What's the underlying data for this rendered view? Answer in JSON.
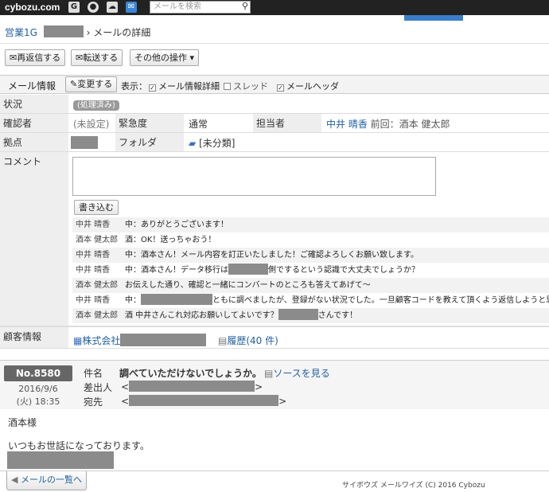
{
  "topbar": {
    "logo": "cybozu.com",
    "icons": [
      "g-icon",
      "target-icon",
      "globe-icon",
      "mail-icon"
    ],
    "search_placeholder": "メールを検索"
  },
  "breadcrumb": {
    "group": "営業1G",
    "separator": "›",
    "title": "メールの詳細"
  },
  "toolbar": {
    "reply": "再返信する",
    "forward": "転送する",
    "other": "その他の操作"
  },
  "infobar": {
    "label": "メール情報",
    "change": "変更する",
    "display": "表示：",
    "opt_detail": "メール情報詳細",
    "opt_thread": "スレッド",
    "opt_header": "メールヘッダ"
  },
  "status": {
    "label": "状況",
    "value": "処理済み"
  },
  "confirm": {
    "label": "確認者",
    "value": "(未設定)",
    "urgency_label": "緊急度",
    "urgency_value": "通常",
    "owner_label": "担当者",
    "owner_value": "中井 晴香",
    "previous": "前回：酒本 健太郎"
  },
  "base": {
    "label": "拠点",
    "folder_label": "フォルダ",
    "folder_value": "[未分類]"
  },
  "comment": {
    "label": "コメント",
    "submit": "書き込む",
    "entries": [
      {
        "who": "中井 晴香",
        "msg": "中：ありがとうございます！"
      },
      {
        "who": "酒本 健太郎",
        "msg": "酒：OK！送っちゃおう！"
      },
      {
        "who": "中井 晴香",
        "msg": "中：酒本さん！メール内容を訂正いたしました！ご確認よろしくお願い致します。"
      },
      {
        "who": "中井 晴香",
        "msg_pre": "中：酒本さん！データ移行は",
        "msg_post": "側でするという認識で大丈夫でしょうか？"
      },
      {
        "who": "酒本 健太郎",
        "msg": "お伝えした通り、確認と一緒にコンバートのところも答えてあげて〜"
      },
      {
        "who": "中井 晴香",
        "msg_pre": "中：",
        "msg_post": "ともに調べましたが、登録がない状況でした。一旦顧客コードを教えて頂くよう返信しようと思う"
      },
      {
        "who": "酒本 健太郎",
        "msg_pre": "酒 中井さんこれ対応お願いしてよいです？",
        "msg_post": "さんです！"
      }
    ]
  },
  "customer": {
    "label": "顧客情報",
    "company_prefix": "株式会社",
    "history": "履歴(40 件)"
  },
  "mail": {
    "number": "No.8580",
    "date": "2016/9/6",
    "time": "(火) 18:35",
    "subject_label": "件名",
    "subject": "調べていただけないでしょうか。",
    "source_link": "ソースを見る",
    "from_label": "差出人",
    "to_label": "宛先",
    "body_greeting": "酒本様",
    "body_line": "いつもお世話になっております。"
  },
  "footer": {
    "back": "メールの一覧へ",
    "copyright": "サイボウズ メールワイズ (C) 2016 Cybozu"
  }
}
